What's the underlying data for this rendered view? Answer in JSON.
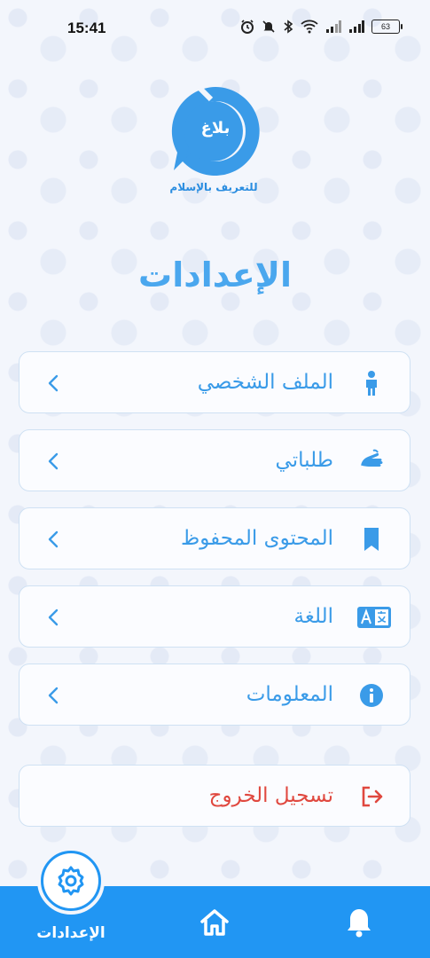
{
  "status_bar": {
    "time": "15:41",
    "battery": "63"
  },
  "logo": {
    "word": "بلاغ",
    "tagline": "للتعريف بالإسلام"
  },
  "page_title": "الإعدادات",
  "menu": [
    {
      "label": "الملف الشخصي",
      "icon": "person-icon"
    },
    {
      "label": "طلباتي",
      "icon": "sign-language-icon"
    },
    {
      "label": "المحتوى المحفوظ",
      "icon": "bookmark-icon"
    },
    {
      "label": "اللغة",
      "icon": "translate-icon"
    },
    {
      "label": "المعلومات",
      "icon": "info-icon"
    }
  ],
  "logout": {
    "label": "تسجيل الخروج",
    "icon": "logout-icon"
  },
  "bottom_nav": {
    "settings_label": "الإعدادات"
  },
  "colors": {
    "accent": "#2196f3",
    "title": "#4aa7ee",
    "menu_text": "#3a9be8",
    "logout": "#e0483f"
  }
}
